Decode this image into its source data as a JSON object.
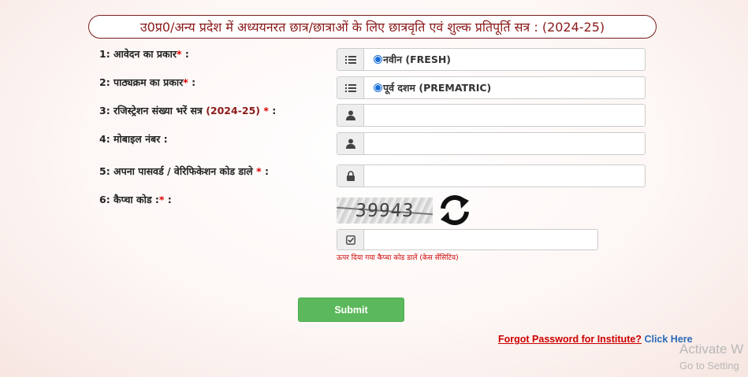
{
  "title": "उ0प्र0/अन्य प्रदेश में अध्ययनरत छात्र/छात्राओं के लिए छात्रवृति एवं शुल्क प्रतिपूर्ति सत्र : (2024-25)",
  "form": {
    "application_type": {
      "label": "1: आवेदन का प्रकार",
      "star": "*",
      "colon": " :",
      "value": "नवीन (FRESH)",
      "icon": "list-icon"
    },
    "course_type": {
      "label": "2: पाठ्यक्रम का प्रकार",
      "star": "*",
      "colon": " :",
      "value": "पूर्व दशम (PREMATRIC)",
      "icon": "list-icon"
    },
    "registration": {
      "label": "3: रजिस्ट्रेशन संख्या भरें सत्र",
      "session": "(2024-25)",
      "star": " *",
      "colon": " :",
      "value": "",
      "icon": "user-icon"
    },
    "mobile": {
      "label": "4: मोबाइल नंबर :",
      "value": "",
      "icon": "user-icon"
    },
    "password": {
      "label": "5: अपना पासवर्ड / वेरिफिकेशन कोड डाले",
      "star": " *",
      "colon": " :",
      "value": "",
      "icon": "lock-icon"
    },
    "captcha": {
      "label": "6: कैप्चा कोड :",
      "star": "*",
      "colon": " :",
      "image_text": "39943",
      "value": "",
      "icon": "check-square-icon",
      "hint": "ऊपर दिया गया कैप्चा कोड डालें (केस सेंसिटिव)"
    }
  },
  "submit_label": "Submit",
  "forgot": {
    "link_text": "Forgot Password for Institute?",
    "click_here": "Click Here"
  },
  "watermark": {
    "line1": "Activate W",
    "line2": "Go to Setting"
  },
  "colors": {
    "title_border": "#7a1d1d",
    "star": "#dd0000",
    "submit": "#5cb85c",
    "forgot_link": "#cc0000",
    "click_here": "#2a6ab8"
  }
}
